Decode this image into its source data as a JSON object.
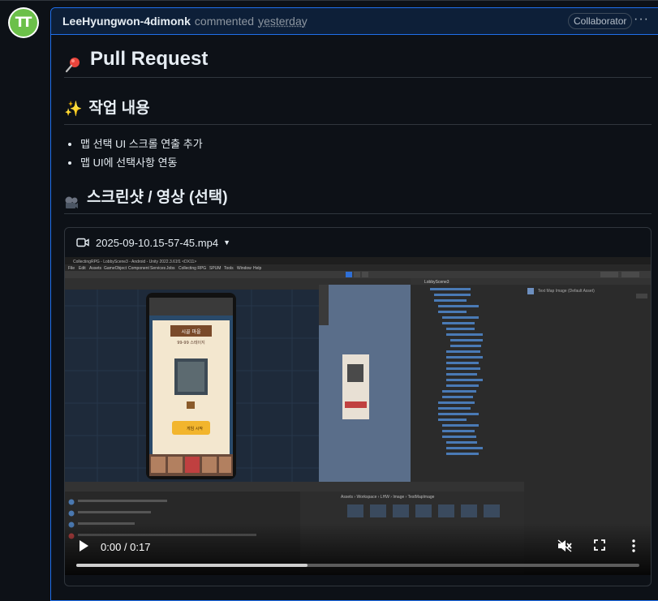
{
  "comment": {
    "author": "LeeHyungwon-4dimonk",
    "action": "commented",
    "time": "yesterday",
    "badge": "Collaborator",
    "avatar_text": "TT"
  },
  "content": {
    "title": "Pull Request",
    "section1_title": "작업 내용",
    "bullets": [
      "맵 선택 UI 스크롤 연출 추가",
      "맵 UI에 선택사항 연동"
    ],
    "section2_title": "스크린샷 / 영상 (선택)"
  },
  "video": {
    "filename": "2025-09-10.15-57-45.mp4",
    "time": "0:00 / 0:17",
    "progress": 0.41,
    "editor_title": "CollectingRPG - LobbyScene3 - Android - Unity 2022.3.61f1 <DX11>",
    "menu": [
      "File",
      "Edit",
      "Assets",
      "GameObject",
      "Component",
      "Services",
      "Jobs",
      "Collecting RPG",
      "SPUM",
      "Tools",
      "Window",
      "Help"
    ],
    "phone_title": "시골 마을",
    "phone_stage": "99-99 스테이지",
    "phone_button": "게임 시작",
    "hierarchy_root": "LobbyScene3",
    "inspector_title": "Text Map Image (Default Asset)",
    "project_path": "Assets › Workspace › LHW › Image › TestMapImage"
  },
  "colors": {
    "accent_border": "#1f6feb",
    "header_bg": "#0d1f38",
    "avatar_green": "#6cc04a"
  },
  "icons": [
    "pin-icon",
    "sparkles-icon",
    "film-reel-icon",
    "video-camera-icon",
    "play-icon",
    "mute-icon",
    "fullscreen-icon",
    "more-vertical-icon",
    "kebab-icon"
  ]
}
